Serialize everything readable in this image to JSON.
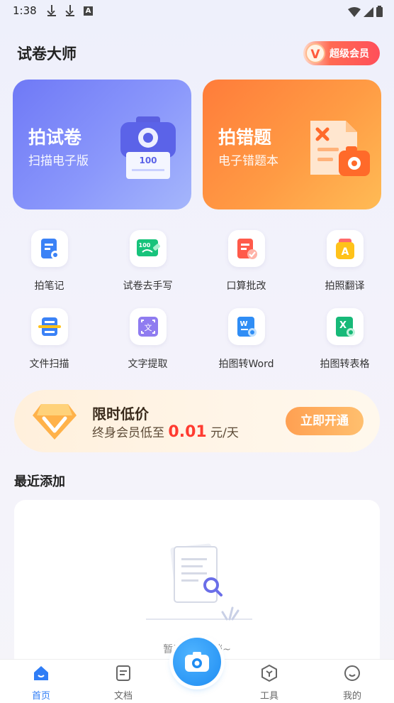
{
  "status_bar": {
    "time": "1:38"
  },
  "header": {
    "title": "试卷大师",
    "vip_label": "超级会员",
    "vip_logo": "V"
  },
  "cards": [
    {
      "title": "拍试卷",
      "subtitle": "扫描电子版",
      "icon": "scanner-icon",
      "icon_text": "100",
      "color": "#7a86f8"
    },
    {
      "title": "拍错题",
      "subtitle": "电子错题本",
      "icon": "error-book-icon",
      "color": "#ff8b3d"
    }
  ],
  "tools": [
    {
      "label": "拍笔记",
      "icon": "note-camera-icon"
    },
    {
      "label": "试卷去手写",
      "icon": "erase-handwriting-icon",
      "icon_text": "100"
    },
    {
      "label": "口算批改",
      "icon": "check-math-icon"
    },
    {
      "label": "拍照翻译",
      "icon": "translate-icon",
      "icon_text": "A"
    },
    {
      "label": "文件扫描",
      "icon": "file-scan-icon"
    },
    {
      "label": "文字提取",
      "icon": "text-extract-icon",
      "icon_text": "文"
    },
    {
      "label": "拍图转Word",
      "icon": "to-word-icon",
      "icon_text": "W"
    },
    {
      "label": "拍图转表格",
      "icon": "to-excel-icon",
      "icon_text": "X"
    }
  ],
  "promo": {
    "title": "限时低价",
    "subtitle_prefix": "终身会员低至 ",
    "price": "0.01",
    "subtitle_suffix": " 元/天",
    "button": "立即开通"
  },
  "recent": {
    "title": "最近添加",
    "empty_text": "暂无扫描文档~"
  },
  "bottom_nav": [
    {
      "label": "首页",
      "icon": "home-icon",
      "active": true
    },
    {
      "label": "文档",
      "icon": "document-icon"
    },
    {
      "label": "工具",
      "icon": "tools-icon"
    },
    {
      "label": "我的",
      "icon": "profile-icon"
    }
  ],
  "colors": {
    "accent": "#2f7df6",
    "price": "#ff3b30"
  }
}
